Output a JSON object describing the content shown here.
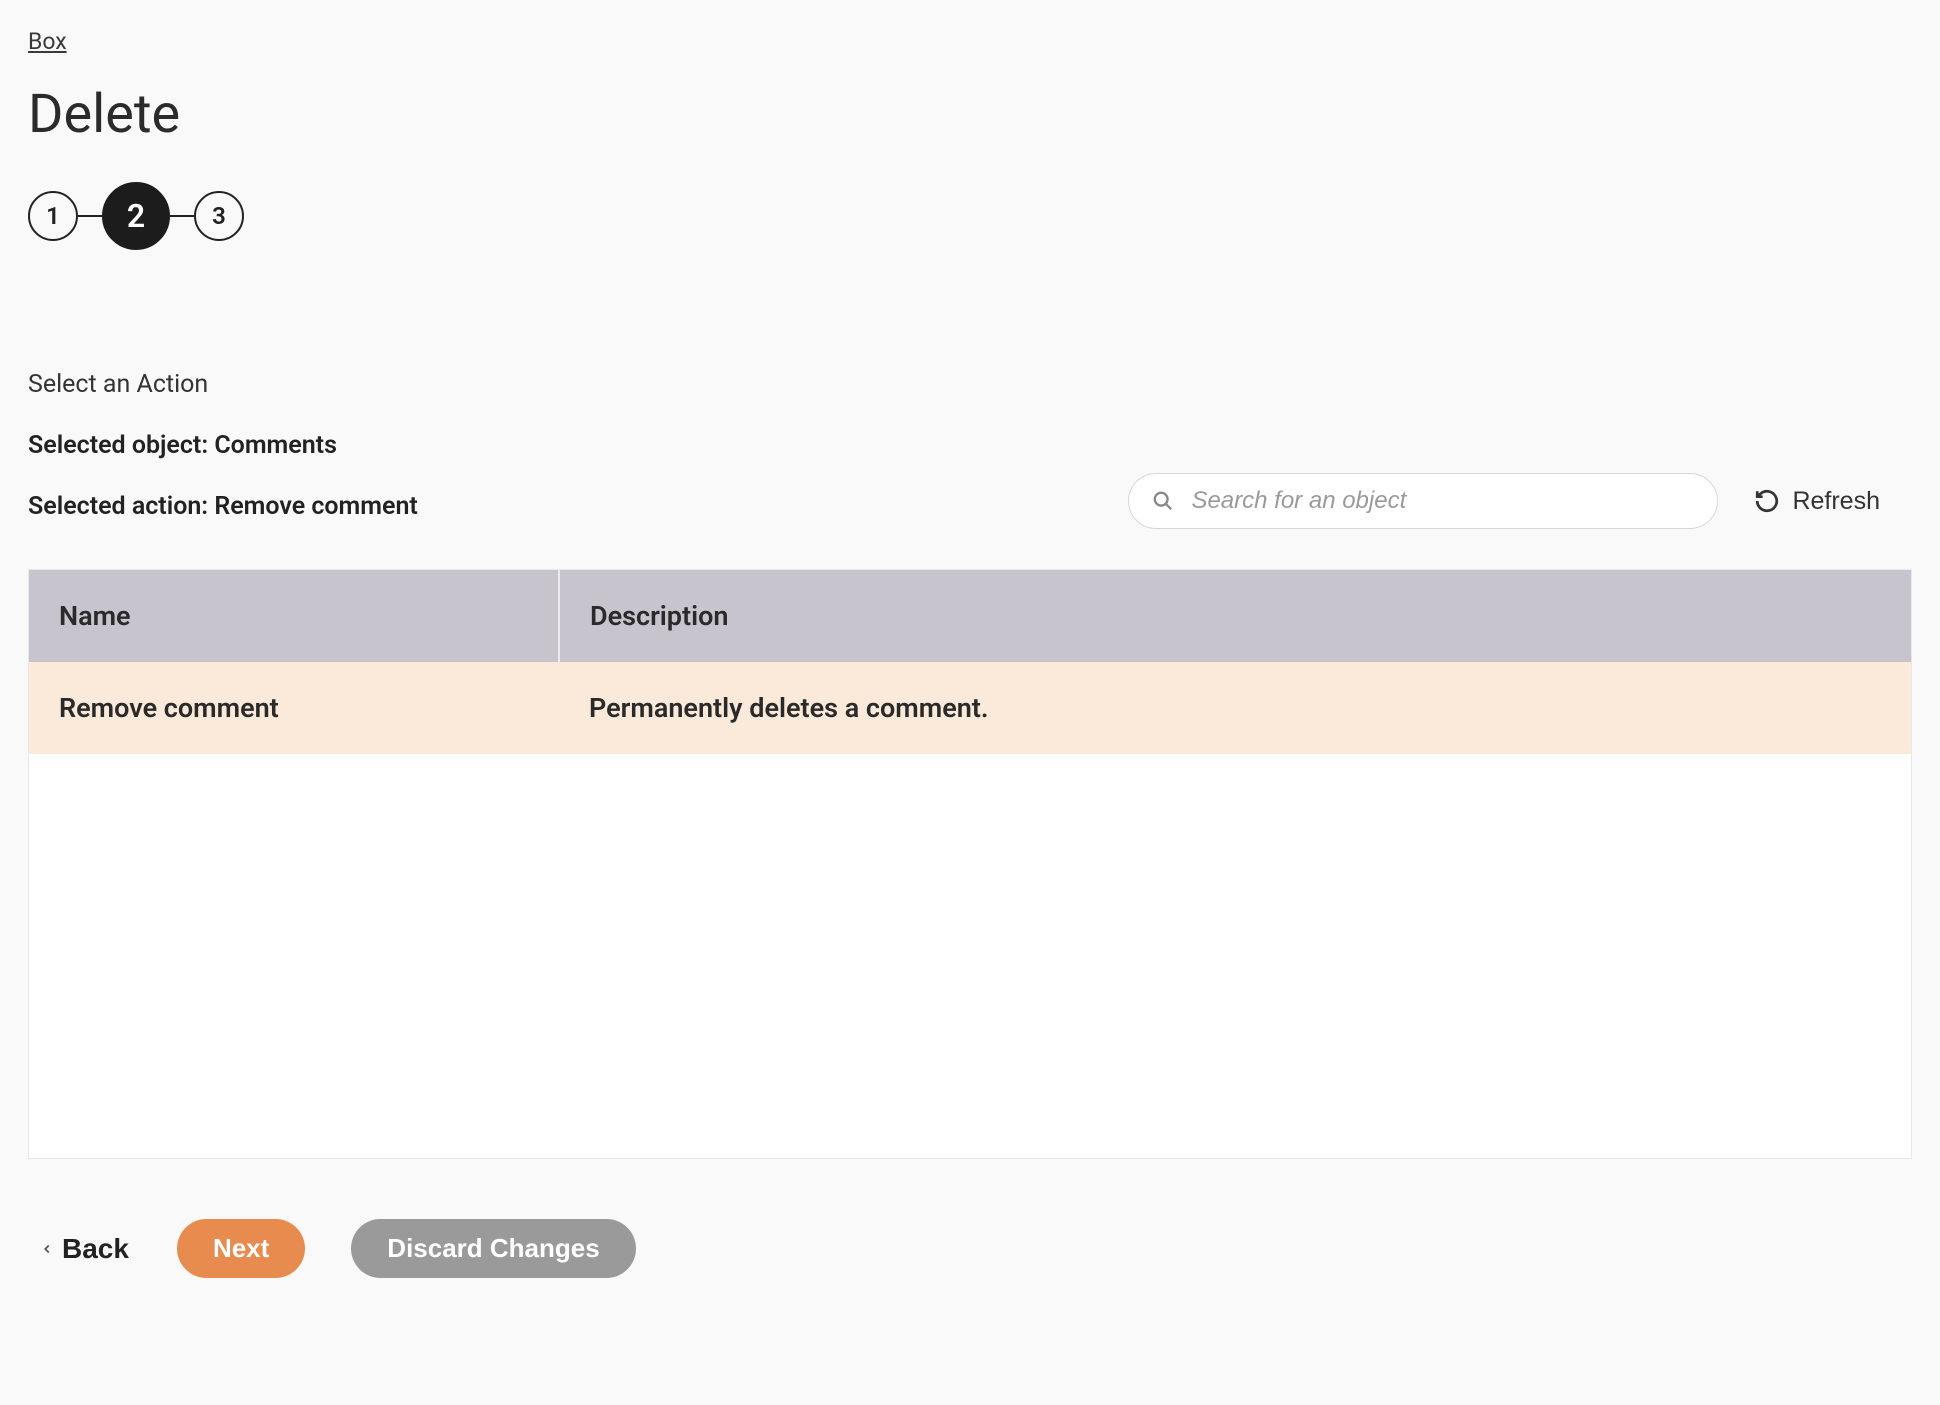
{
  "breadcrumb": {
    "label": "Box"
  },
  "page": {
    "title": "Delete"
  },
  "stepper": {
    "steps": [
      "1",
      "2",
      "3"
    ],
    "active_index": 1
  },
  "section": {
    "label": "Select an Action",
    "selected_object": "Selected object: Comments",
    "selected_action": "Selected action: Remove comment"
  },
  "search": {
    "placeholder": "Search for an object"
  },
  "refresh": {
    "label": "Refresh"
  },
  "table": {
    "headers": {
      "name": "Name",
      "description": "Description"
    },
    "rows": [
      {
        "name": "Remove comment",
        "description": "Permanently deletes a comment."
      }
    ]
  },
  "footer": {
    "back": "Back",
    "next": "Next",
    "discard": "Discard Changes"
  }
}
